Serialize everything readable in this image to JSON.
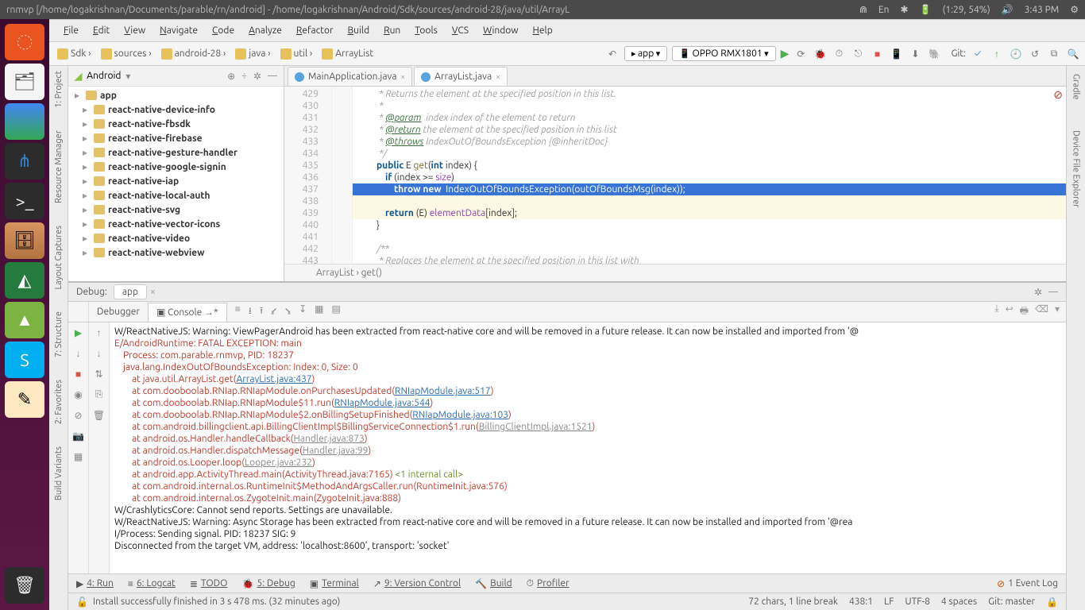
{
  "ubuntu_title": "rnmvp [/home/logakrishnan/Documents/parable/rn/android] - /home/logakrishnan/Android/Sdk/sources/android-28/java/util/ArrayL",
  "topright": {
    "lang": "En",
    "battery": "(1:29, 54%)",
    "time": "3:43 PM"
  },
  "menu": [
    "File",
    "Edit",
    "View",
    "Navigate",
    "Code",
    "Analyze",
    "Refactor",
    "Build",
    "Run",
    "Tools",
    "VCS",
    "Window",
    "Help"
  ],
  "breadcrumbs": [
    "Sdk",
    "sources",
    "android-28",
    "java",
    "util",
    "ArrayList"
  ],
  "run_config": "app",
  "device": "OPPO RMX1801",
  "git_label": "Git:",
  "left_tool_labels": [
    "1: Project",
    "Resource Manager",
    "Layout Captures",
    "7: Structure",
    "2: Favorites",
    "Build Variants"
  ],
  "right_tool_labels": [
    "Gradle",
    "Device File Explorer"
  ],
  "project_title": "Android",
  "tree_items": [
    "app",
    "react-native-device-info",
    "react-native-fbsdk",
    "react-native-firebase",
    "react-native-gesture-handler",
    "react-native-google-signin",
    "react-native-iap",
    "react-native-local-auth",
    "react-native-svg",
    "react-native-vector-icons",
    "react-native-video",
    "react-native-webview"
  ],
  "tabs": [
    {
      "name": "MainApplication.java",
      "active": false
    },
    {
      "name": "ArrayList.java",
      "active": true
    }
  ],
  "code": {
    "lines": [
      {
        "n": 429,
        "t": "         * Returns the element at the specified position in this list.",
        "cls": "jd"
      },
      {
        "n": 430,
        "t": "         *",
        "cls": "jd"
      },
      {
        "n": 431,
        "t": "         * @param  index index of the element to return",
        "cls": "jd",
        "tag": "@param"
      },
      {
        "n": 432,
        "t": "         * @return the element at the specified position in this list",
        "cls": "jd",
        "tag": "@return"
      },
      {
        "n": 433,
        "t": "         * @throws IndexOutOfBoundsException {@inheritDoc}",
        "cls": "jd",
        "tag": "@throws"
      },
      {
        "n": 434,
        "t": "         */",
        "cls": "jd"
      },
      {
        "n": 435,
        "t": "        public E get(int index) {",
        "cls": "sig"
      },
      {
        "n": 436,
        "t": "            if (index >= size)",
        "cls": "body"
      },
      {
        "n": 437,
        "t": "                throw new IndexOutOfBoundsException(outOfBoundsMsg(index));",
        "cls": "hl",
        "bp": true
      },
      {
        "n": 438,
        "t": "",
        "cls": "yel"
      },
      {
        "n": 439,
        "t": "            return (E) elementData[index];",
        "cls": "yel"
      },
      {
        "n": 440,
        "t": "        }",
        "cls": ""
      },
      {
        "n": 441,
        "t": "",
        "cls": ""
      },
      {
        "n": 442,
        "t": "        /**",
        "cls": "jd"
      },
      {
        "n": 443,
        "t": "         * Replaces the element at the specified position in this list with",
        "cls": "jd"
      }
    ],
    "breadcrumb": "ArrayList  ›  get()"
  },
  "debug": {
    "title": "Debug:",
    "config": "app",
    "tabs": [
      "Debugger",
      "Console"
    ],
    "active_tab": "Console"
  },
  "console": [
    {
      "c": "w",
      "t": "W/ReactNativeJS: Warning: ViewPagerAndroid has been extracted from react-native core and will be removed in a future release. It can now be installed and imported from '@"
    },
    {
      "c": "e",
      "t": "E/AndroidRuntime: FATAL EXCEPTION: main"
    },
    {
      "c": "e",
      "t": "    Process: com.parable.rnmvp, PID: 18237"
    },
    {
      "c": "e",
      "t": "    java.lang.IndexOutOfBoundsException: Index: 0, Size: 0"
    },
    {
      "c": "e",
      "t": "        at java.util.ArrayList.get(",
      "lk": "ArrayList.java:437",
      "suf": ")"
    },
    {
      "c": "e",
      "t": "        at com.dooboolab.RNIap.RNIapModule.onPurchasesUpdated(",
      "lk": "RNIapModule.java:517",
      "suf": ")"
    },
    {
      "c": "e",
      "t": "        at com.dooboolab.RNIap.RNIapModule$11.run(",
      "lk": "RNIapModule.java:544",
      "suf": ")"
    },
    {
      "c": "e",
      "t": "        at com.dooboolab.RNIap.RNIapModule$2.onBillingSetupFinished(",
      "lk": "RNIapModule.java:103",
      "suf": ")"
    },
    {
      "c": "e",
      "t": "        at com.android.billingclient.api.BillingClientImpl$BillingServiceConnection$1.run(",
      "lkg": "BillingClientImpl.java:1521",
      "suf": ")"
    },
    {
      "c": "e",
      "t": "        at android.os.Handler.handleCallback(",
      "lkg": "Handler.java:873",
      "suf": ")"
    },
    {
      "c": "e",
      "t": "        at android.os.Handler.dispatchMessage(",
      "lkg": "Handler.java:99",
      "suf": ")"
    },
    {
      "c": "e",
      "t": "        at android.os.Looper.loop(",
      "lkg": "Looper.java:232",
      "suf": ")"
    },
    {
      "c": "e",
      "t": "        at android.app.ActivityThread.main(ActivityThread.java:7165) ",
      "gr": "<1 internal call>"
    },
    {
      "c": "e",
      "t": "        at com.android.internal.os.RuntimeInit$MethodAndArgsCaller.run(RuntimeInit.java:576)"
    },
    {
      "c": "e",
      "t": "        at com.android.internal.os.ZygoteInit.main(ZygoteInit.java:888)"
    },
    {
      "c": "w",
      "t": "W/CrashlyticsCore: Cannot send reports. Settings are unavailable."
    },
    {
      "c": "w",
      "t": "W/ReactNativeJS: Warning: Async Storage has been extracted from react-native core and will be removed in a future release. It can now be installed and imported from '@rea"
    },
    {
      "c": "w",
      "t": "I/Process: Sending signal. PID: 18237 SIG: 9"
    },
    {
      "c": "w",
      "t": "Disconnected from the target VM, address: 'localhost:8600', transport: 'socket'"
    }
  ],
  "bottom_items": [
    "4: Run",
    "6: Logcat",
    "TODO",
    "5: Debug",
    "Terminal",
    "9: Version Control",
    "Build",
    "Profiler"
  ],
  "event_log": "1 Event Log",
  "status_msg": "Install successfully finished in 3 s 478 ms. (32 minutes ago)",
  "status_right": [
    "72 chars, 1 line break",
    "438:1",
    "LF",
    "UTF-8",
    "4 spaces",
    "Git: master"
  ]
}
